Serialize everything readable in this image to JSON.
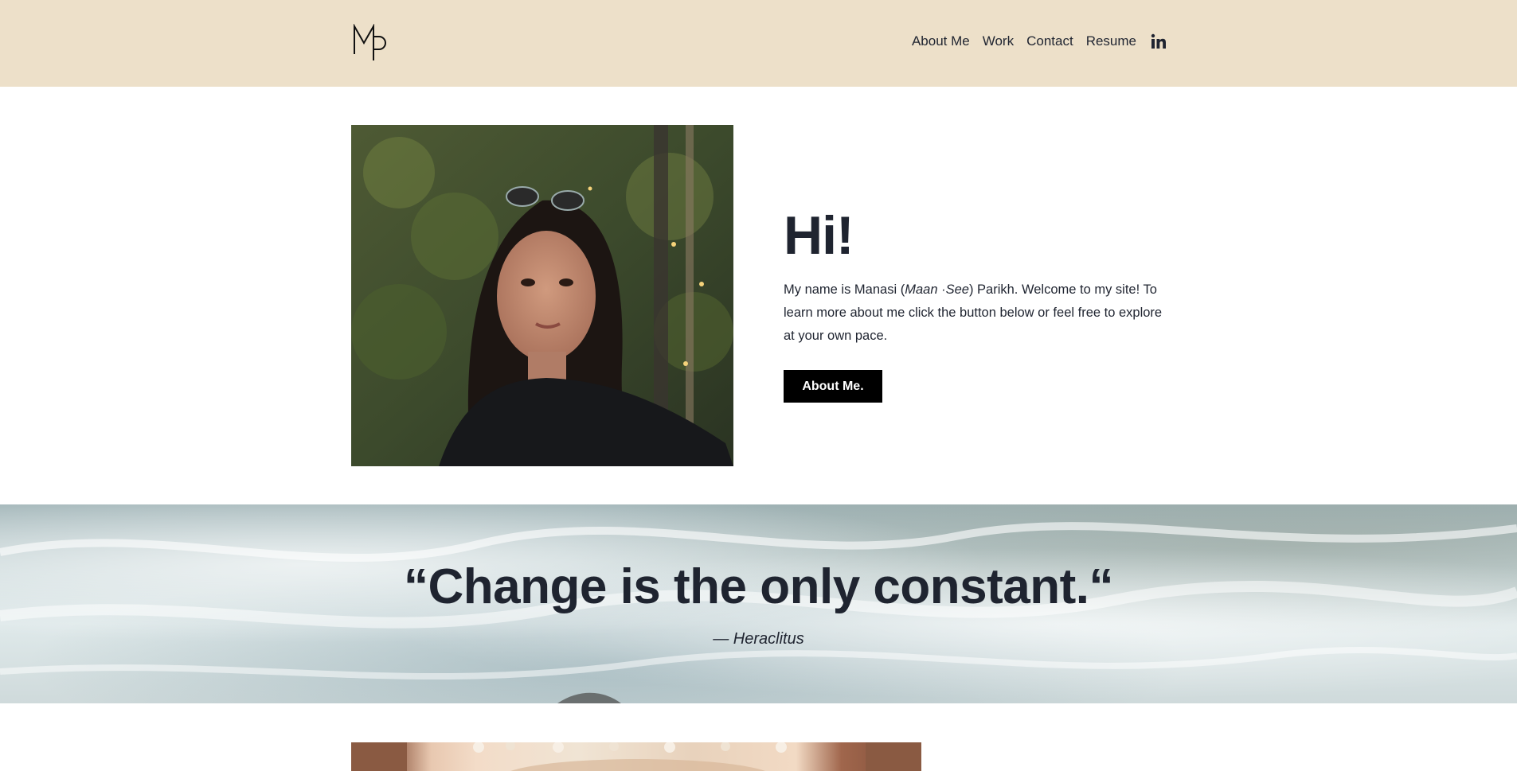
{
  "header": {
    "logo_text": "MP",
    "nav": [
      {
        "label": "About Me"
      },
      {
        "label": "Work"
      },
      {
        "label": "Contact"
      },
      {
        "label": "Resume"
      }
    ],
    "social_icon": "linkedin-icon"
  },
  "hero": {
    "heading": "Hi!",
    "intro_before": "My name is Manasi (",
    "intro_pronunciation": "Maan ·See",
    "intro_after": ") Parikh. Welcome to my site! To learn more about me click the button below or feel free to explore at your own pace.",
    "button_label": "About Me."
  },
  "quote": {
    "text": "“Change is the only constant.“",
    "author": "— Heraclitus"
  },
  "colors": {
    "header_bg": "#ede0c9",
    "text": "#1f2430",
    "button_bg": "#000000",
    "button_text": "#ffffff"
  }
}
